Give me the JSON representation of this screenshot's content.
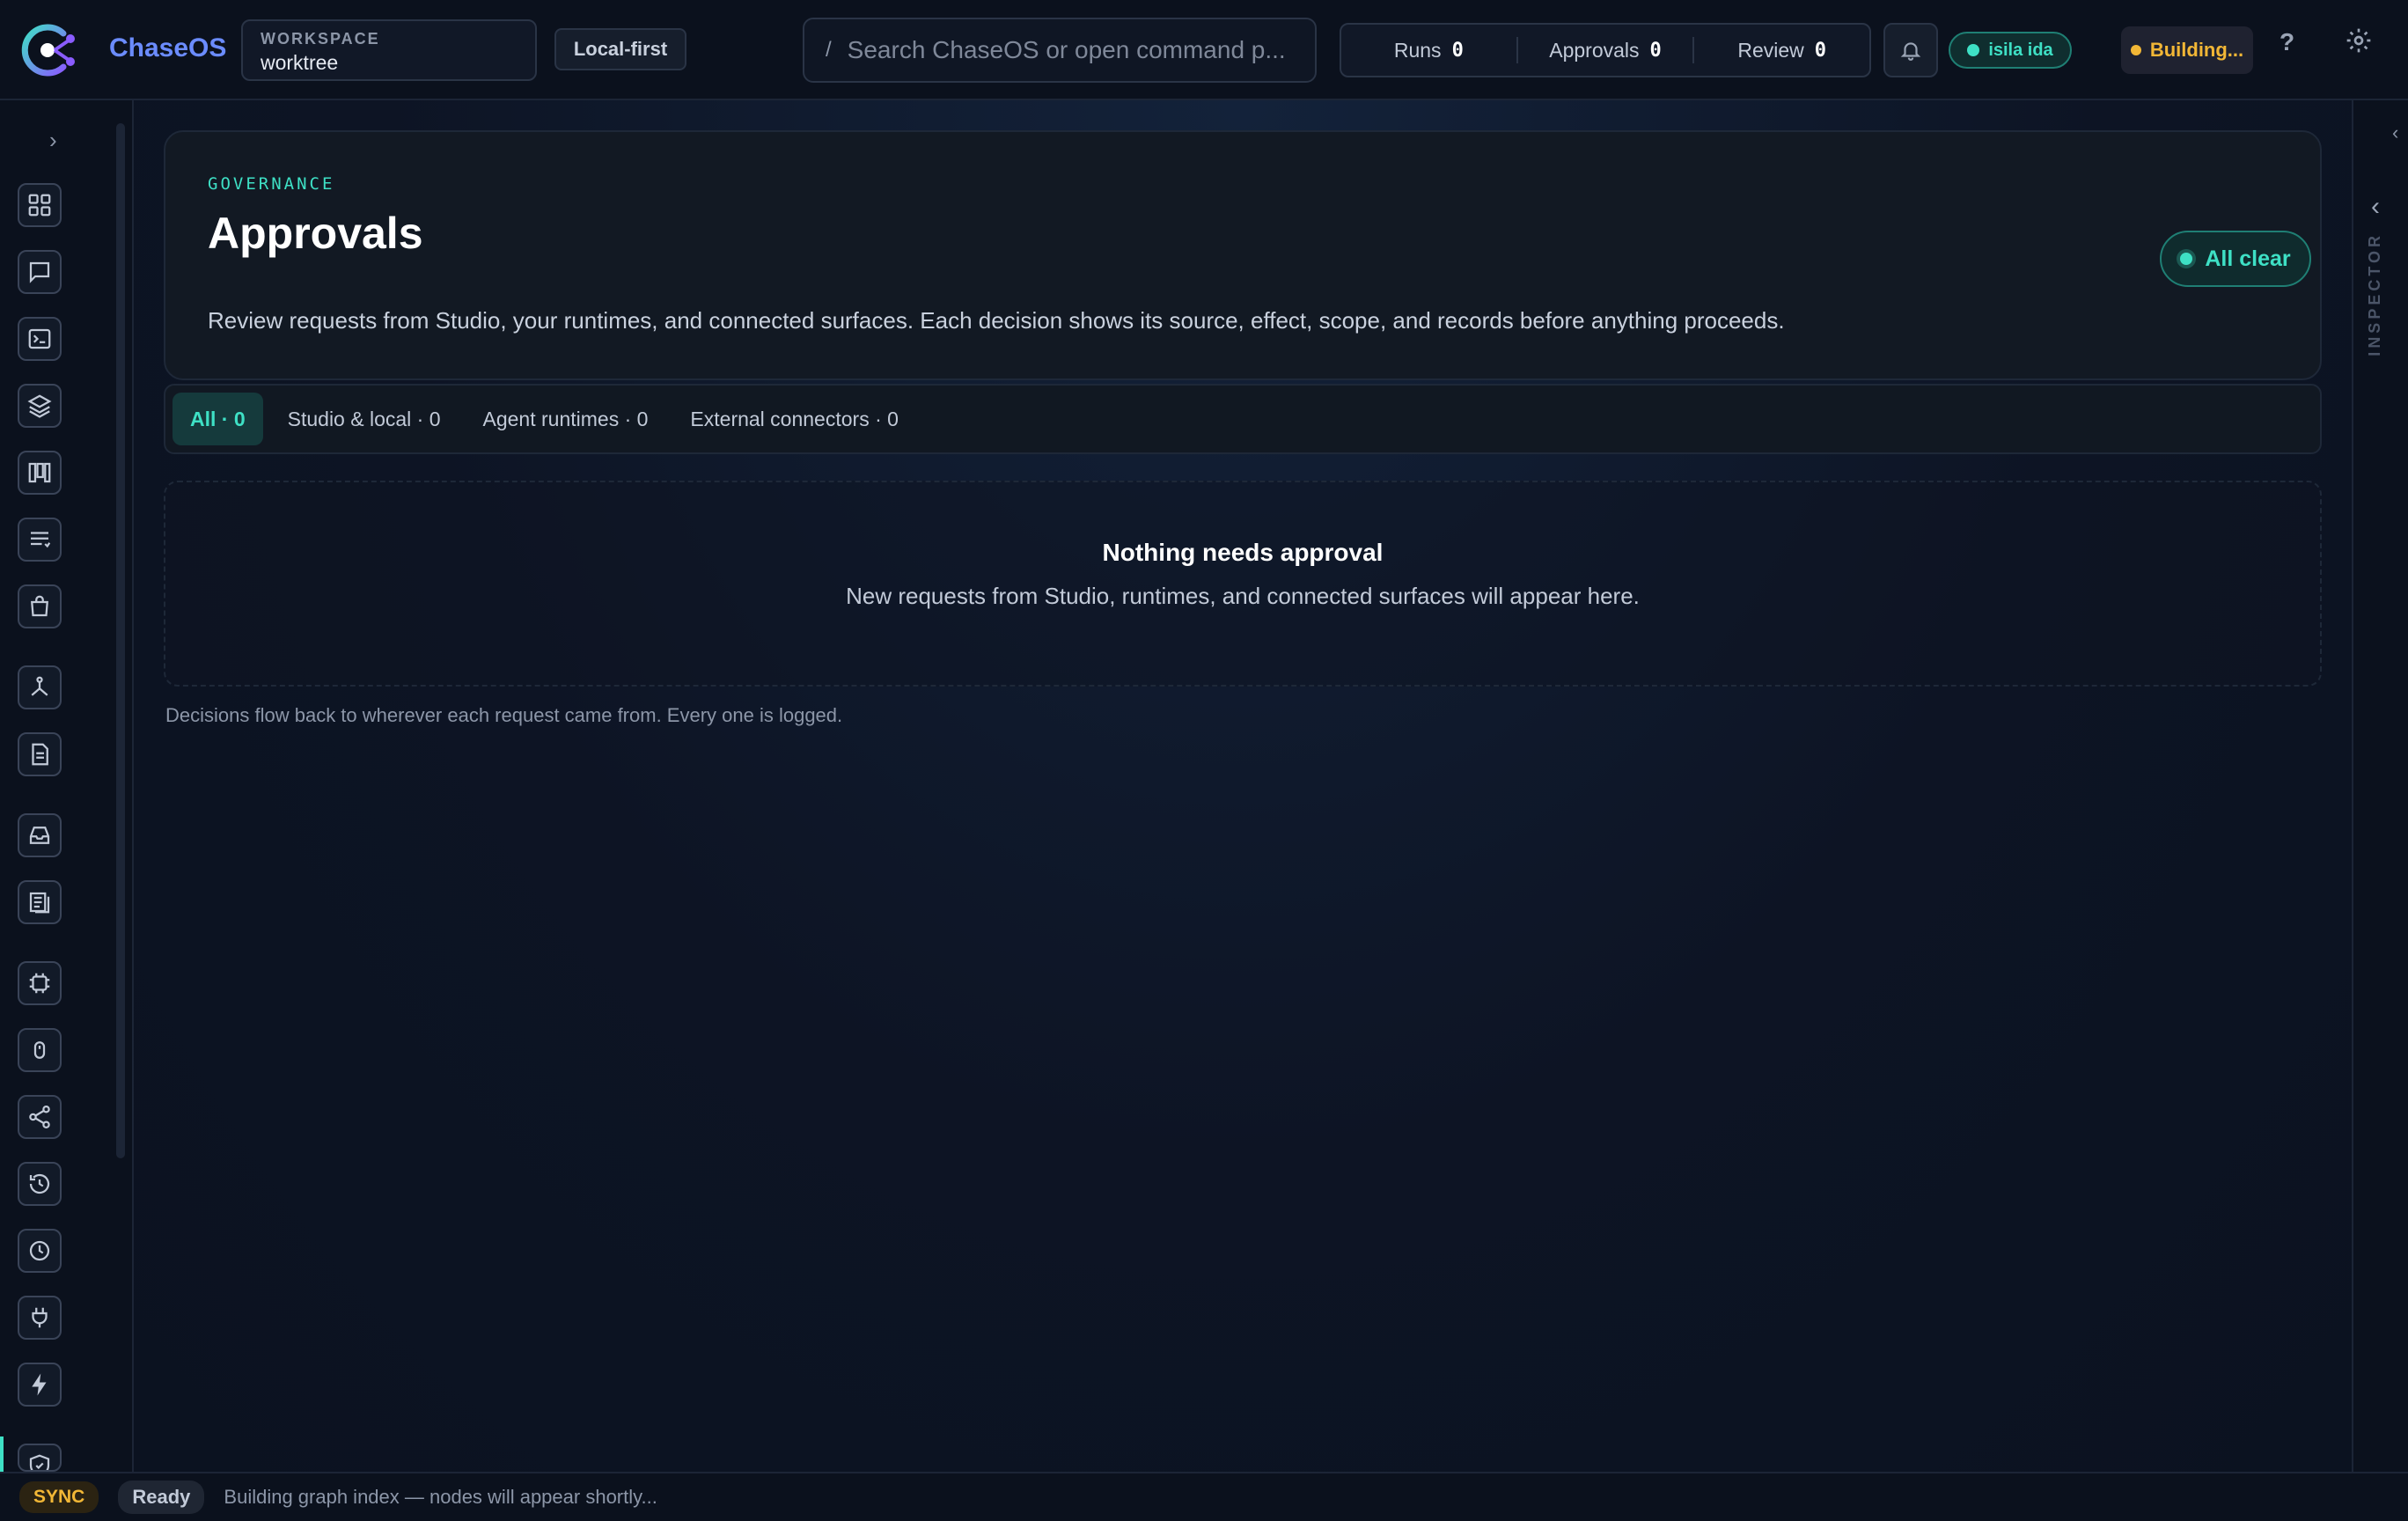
{
  "topbar": {
    "brand": "ChaseOS",
    "workspace_label": "WORKSPACE",
    "workspace_value": "worktree",
    "mode_chip": "Local-first",
    "search_prefix": "/",
    "search_placeholder": "Search ChaseOS or open command p...",
    "counters": [
      {
        "label": "Runs",
        "value": "0"
      },
      {
        "label": "Approvals",
        "value": "0"
      },
      {
        "label": "Review",
        "value": "0"
      }
    ],
    "user": "isila ida",
    "build_status": "Building...",
    "help": "?"
  },
  "rail": {
    "toggle": "›",
    "items": [
      {
        "icon": "dashboard-icon"
      },
      {
        "icon": "chat-icon"
      },
      {
        "icon": "terminal-icon"
      },
      {
        "icon": "layers-icon"
      },
      {
        "icon": "kanban-icon"
      },
      {
        "icon": "list-icon"
      },
      {
        "icon": "shopping-bag-icon"
      },
      {
        "icon": "graph-icon"
      },
      {
        "icon": "document-icon"
      },
      {
        "icon": "inbox-icon"
      },
      {
        "icon": "pages-icon"
      },
      {
        "icon": "chip-icon"
      },
      {
        "icon": "mouse-icon"
      },
      {
        "icon": "share-icon"
      },
      {
        "icon": "history-icon"
      },
      {
        "icon": "clock-icon"
      },
      {
        "icon": "plug-icon"
      },
      {
        "icon": "bolt-icon"
      },
      {
        "icon": "shield-check-icon"
      }
    ]
  },
  "header": {
    "eyebrow": "GOVERNANCE",
    "title": "Approvals",
    "description": "Review requests from Studio, your runtimes, and connected surfaces. Each decision shows its source, effect, scope, and records before anything proceeds.",
    "status_chip": "All clear"
  },
  "tabs": [
    {
      "label": "All · 0",
      "active": true
    },
    {
      "label": "Studio & local · 0",
      "active": false
    },
    {
      "label": "Agent runtimes · 0",
      "active": false
    },
    {
      "label": "External connectors · 0",
      "active": false
    }
  ],
  "empty_state": {
    "title": "Nothing needs approval",
    "description": "New requests from Studio, runtimes, and connected surfaces will appear here."
  },
  "footnote": "Decisions flow back to wherever each request came from. Every one is logged.",
  "inspector": {
    "top_chevron": "‹",
    "chevron": "‹",
    "label": "INSPECTOR"
  },
  "statusbar": {
    "sync": "SYNC",
    "ready": "Ready",
    "message": "Building graph index — nodes will appear shortly..."
  },
  "colors": {
    "accent": "#3ee0c5",
    "brand": "#6b8cff",
    "warning": "#f2b736",
    "background": "#0d1424"
  }
}
